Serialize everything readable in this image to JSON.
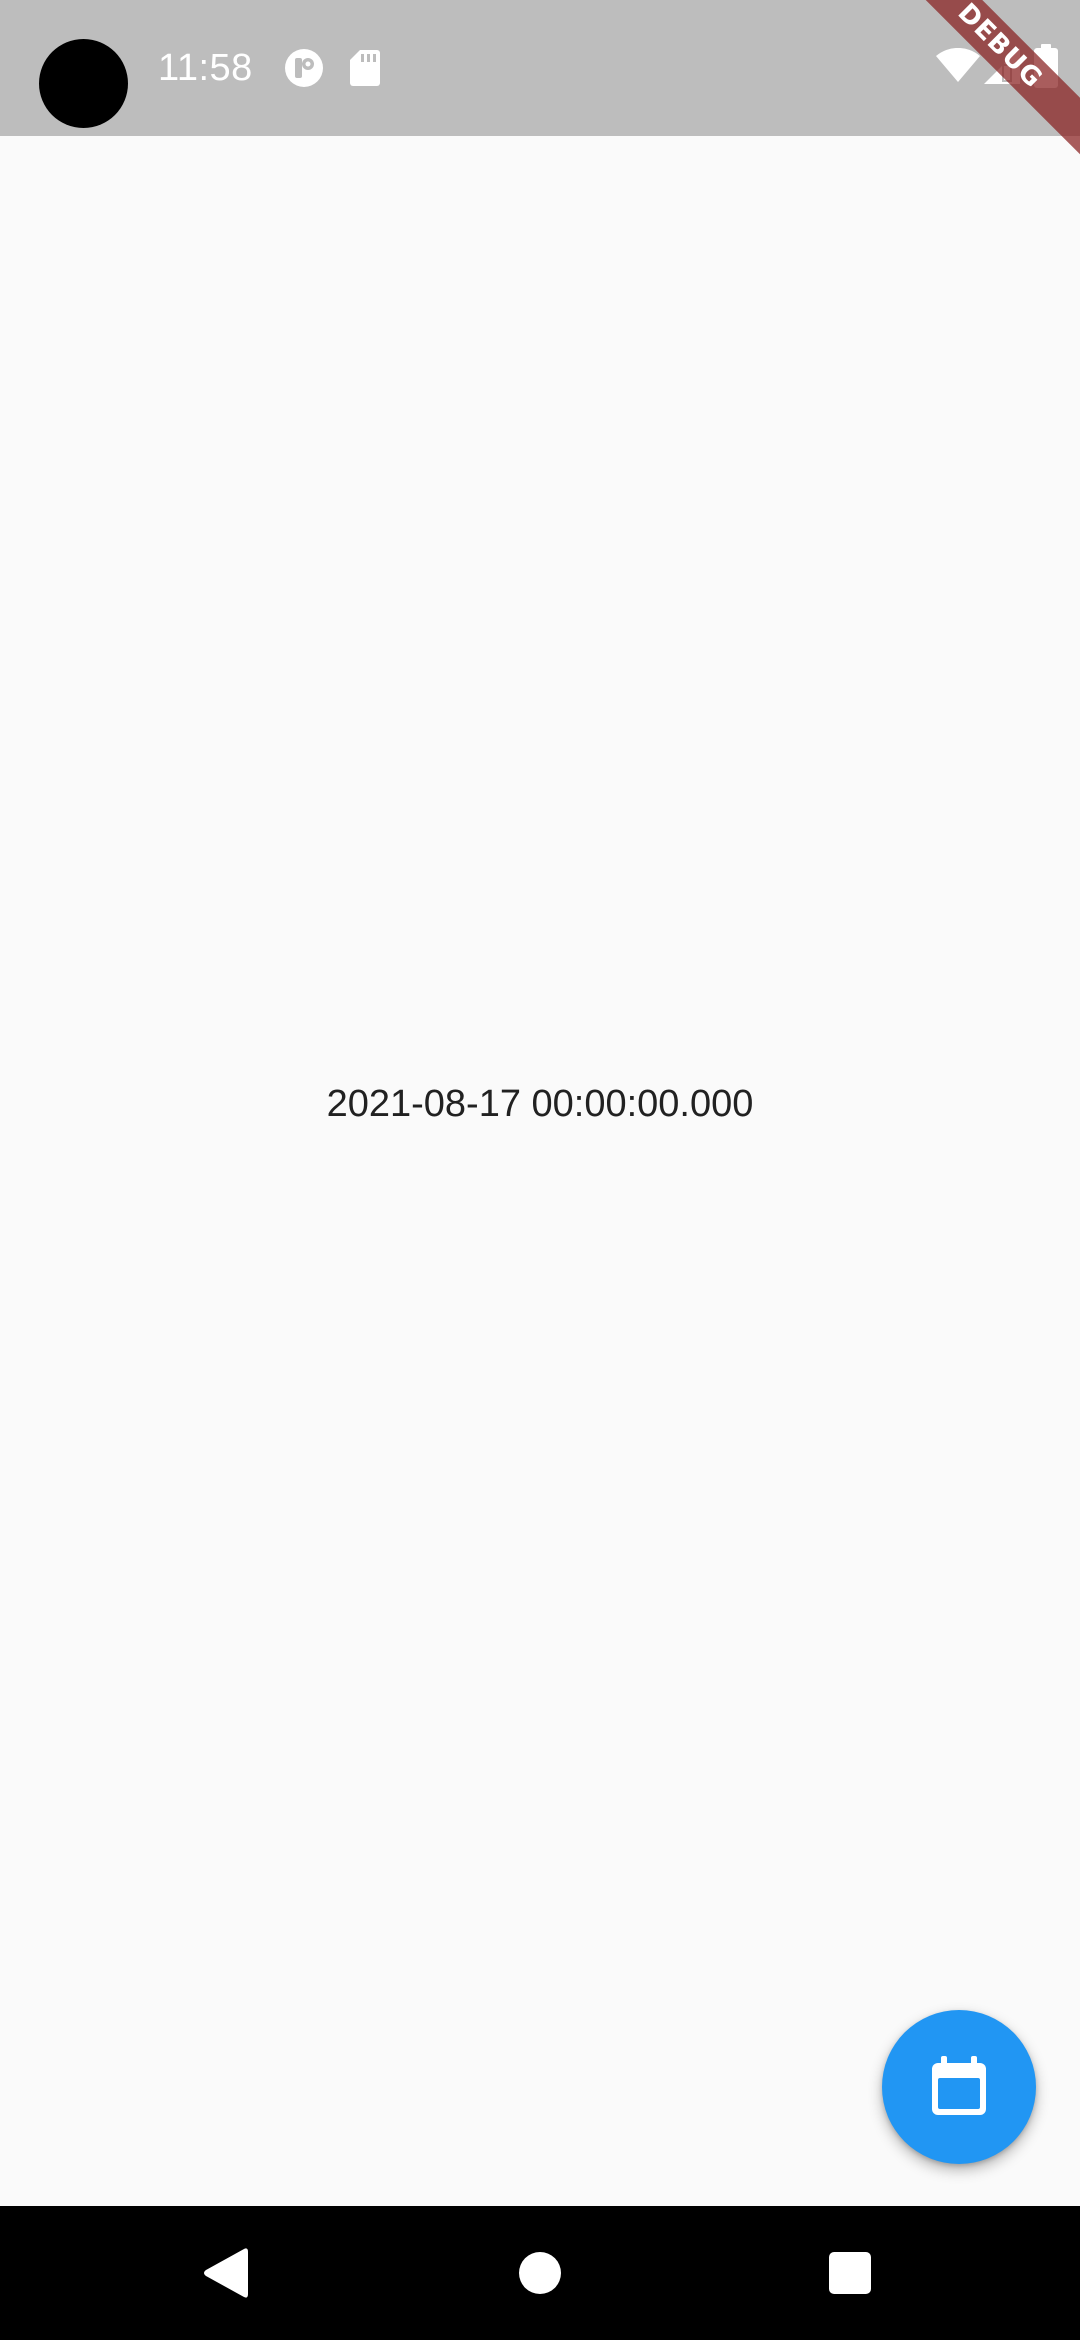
{
  "status_bar": {
    "time": "11:58",
    "background_color": "#bdbdbd",
    "left_icons": [
      "camera-cutout",
      "app-notification-icon",
      "sd-card-icon"
    ],
    "right_icons": [
      "wifi-icon",
      "cell-signal-icon",
      "battery-icon"
    ]
  },
  "debug_banner": {
    "label": "DEBUG"
  },
  "main": {
    "selected_date": "2021-08-17 00:00:00.000"
  },
  "fab": {
    "icon": "calendar-icon",
    "color": "#2196f3"
  },
  "nav_bar": {
    "buttons": [
      "back-icon",
      "home-icon",
      "recents-icon"
    ]
  }
}
